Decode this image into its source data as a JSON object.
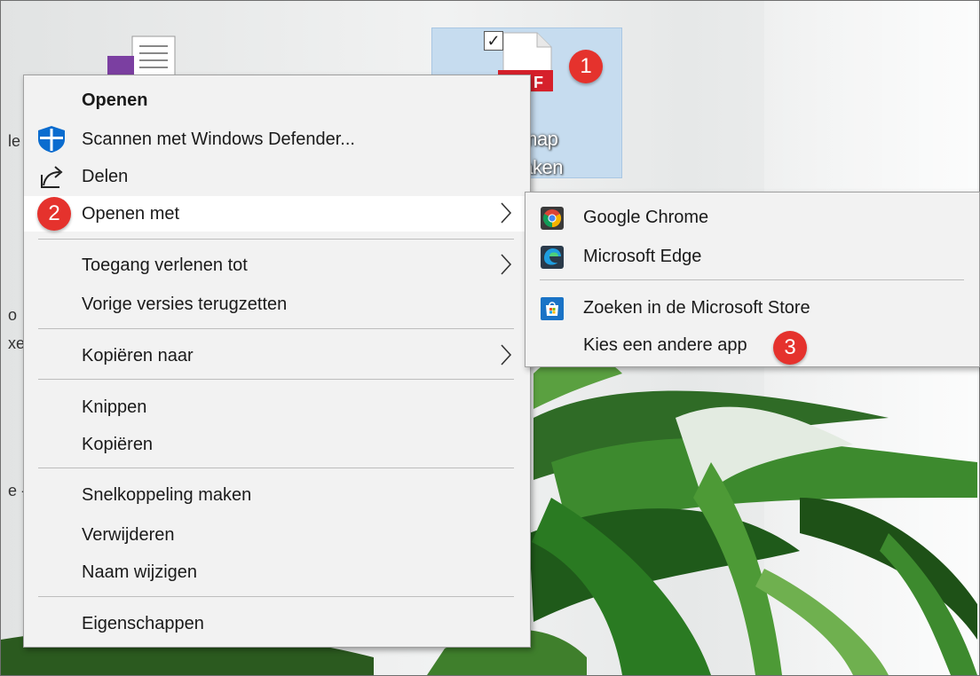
{
  "desktop": {
    "selected_file": {
      "label_line1": "s - map",
      "label_line2": "n maken",
      "checkbox_glyph": "✓",
      "pdf_tag": "F"
    },
    "partial_edge_text": [
      "le",
      "o",
      "xe",
      "e -"
    ]
  },
  "badges": {
    "step1": "1",
    "step2": "2",
    "step3": "3"
  },
  "context_menu": {
    "items": [
      {
        "label": "Openen"
      },
      {
        "label": "Scannen met Windows Defender..."
      },
      {
        "label": "Delen"
      },
      {
        "label": "Openen met"
      },
      {
        "label": "Toegang verlenen tot"
      },
      {
        "label": "Vorige versies terugzetten"
      },
      {
        "label": "Kopiëren naar"
      },
      {
        "label": "Knippen"
      },
      {
        "label": "Kopiëren"
      },
      {
        "label": "Snelkoppeling maken"
      },
      {
        "label": "Verwijderen"
      },
      {
        "label": "Naam wijzigen"
      },
      {
        "label": "Eigenschappen"
      }
    ]
  },
  "submenu": {
    "items": [
      {
        "label": "Google Chrome",
        "icon": "chrome-icon"
      },
      {
        "label": "Microsoft Edge",
        "icon": "edge-icon"
      },
      {
        "label": "Zoeken in de Microsoft Store",
        "icon": "store-icon"
      },
      {
        "label": "Kies een andere app"
      }
    ]
  },
  "colors": {
    "badge_red": "#e5322d",
    "defender_blue": "#0a6ccf",
    "selection_blue": "#c6dcef",
    "menu_background": "#f2f2f2",
    "highlight": "#ffffff"
  }
}
